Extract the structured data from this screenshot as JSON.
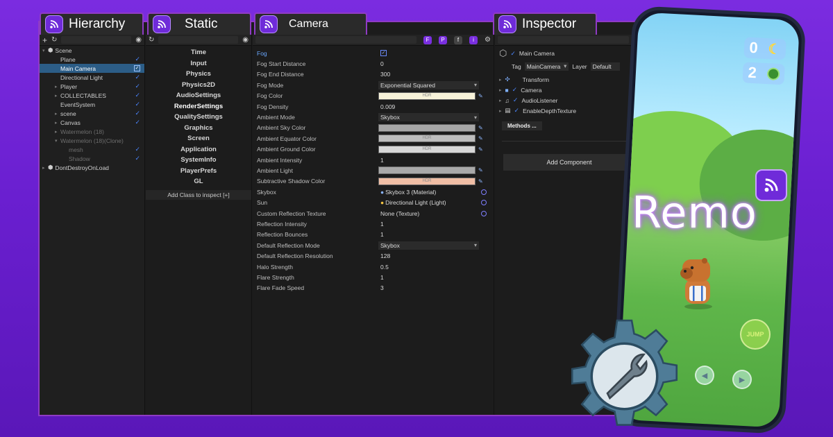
{
  "tabs": {
    "hierarchy": "Hierarchy",
    "static": "Static",
    "camera": "Camera",
    "inspector": "Inspector"
  },
  "hierarchy": {
    "toolbar_add": "+",
    "items": [
      {
        "label": "Scene",
        "indent": 0,
        "expanded": true,
        "bold": true
      },
      {
        "label": "Plane",
        "indent": 1
      },
      {
        "label": "Main Camera",
        "indent": 1,
        "selected": true
      },
      {
        "label": "Directional Light",
        "indent": 1
      },
      {
        "label": "Player",
        "indent": 1,
        "arrow": true
      },
      {
        "label": "COLLECTABLES",
        "indent": 1,
        "arrow": true
      },
      {
        "label": "EventSystem",
        "indent": 1
      },
      {
        "label": "scene",
        "indent": 1,
        "arrow": true
      },
      {
        "label": "Canvas",
        "indent": 1,
        "arrow": true
      },
      {
        "label": "Watermelon (18)",
        "indent": 1,
        "arrow": true,
        "dim": true
      },
      {
        "label": "Watermelon (18)(Clone)",
        "indent": 1,
        "arrow": true,
        "dim": true,
        "expanded": true
      },
      {
        "label": "mesh",
        "indent": 2,
        "dim": true
      },
      {
        "label": "Shadow",
        "indent": 2,
        "dim": true
      },
      {
        "label": "DontDestroyOnLoad",
        "indent": 0,
        "arrow": true
      }
    ]
  },
  "static": {
    "items": [
      "Time",
      "Input",
      "Physics",
      "Physics2D",
      "AudioSettings",
      "RenderSettings",
      "QualitySettings",
      "Graphics",
      "Screen",
      "Application",
      "SystemInfo",
      "PlayerPrefs",
      "GL"
    ],
    "selected": "RenderSettings",
    "add_button": "Add Class to inspect [+]"
  },
  "camera": {
    "toolbar_badges": [
      "F",
      "P",
      "f",
      "i"
    ],
    "properties": [
      {
        "label": "Fog",
        "value": "✓",
        "type": "check",
        "highlight": true
      },
      {
        "label": "Fog Start Distance",
        "value": "0",
        "type": "text"
      },
      {
        "label": "Fog End Distance",
        "value": "300",
        "type": "text"
      },
      {
        "label": "Fog Mode",
        "value": "Exponential Squared",
        "type": "dropdown"
      },
      {
        "label": "Fog Color",
        "value": "HDR",
        "type": "color",
        "color": "#f6f1d8"
      },
      {
        "label": "Fog Density",
        "value": "0.009",
        "type": "text"
      },
      {
        "label": "Ambient Mode",
        "value": "Skybox",
        "type": "dropdown"
      },
      {
        "label": "Ambient Sky Color",
        "value": "",
        "type": "color",
        "color": "#a7a7a7"
      },
      {
        "label": "Ambient Equator Color",
        "value": "HDR",
        "type": "color",
        "color": "#bdbdbd"
      },
      {
        "label": "Ambient Ground Color",
        "value": "HDR",
        "type": "color",
        "color": "#d7d7d7"
      },
      {
        "label": "Ambient Intensity",
        "value": "1",
        "type": "text"
      },
      {
        "label": "Ambient Light",
        "value": "",
        "type": "color",
        "color": "#a9a9a9"
      },
      {
        "label": "Subtractive Shadow Color",
        "value": "HDR",
        "type": "color",
        "color": "#f0bea5"
      },
      {
        "label": "Skybox",
        "value": "Skybox 3 (Material)",
        "type": "object"
      },
      {
        "label": "Sun",
        "value": "Directional Light (Light)",
        "type": "object"
      },
      {
        "label": "Custom Reflection Texture",
        "value": "None (Texture)",
        "type": "object"
      },
      {
        "label": "Reflection Intensity",
        "value": "1",
        "type": "text"
      },
      {
        "label": "Reflection Bounces",
        "value": "1",
        "type": "text"
      },
      {
        "label": "Default Reflection Mode",
        "value": "Skybox",
        "type": "dropdown"
      },
      {
        "label": "Default Reflection Resolution",
        "value": "128",
        "type": "text"
      },
      {
        "label": "Halo Strength",
        "value": "0.5",
        "type": "text"
      },
      {
        "label": "Flare Strength",
        "value": "1",
        "type": "text"
      },
      {
        "label": "Flare Fade Speed",
        "value": "3",
        "type": "text"
      }
    ]
  },
  "inspector": {
    "object_name": "Main Camera",
    "tag_label": "Tag",
    "tag_value": "MainCamera",
    "layer_label": "Layer",
    "layer_value": "Default",
    "components": [
      "Transform",
      "Camera",
      "AudioListener",
      "EnableDepthTexture"
    ],
    "methods_button": "Methods ...",
    "add_component": "Add Component"
  },
  "game": {
    "banana_count": "0",
    "melon_count": "2",
    "jump_label": "JUMP"
  },
  "brand": {
    "title": "Remo",
    "accent": "#7a2fe0",
    "frame": "#8f3bc4"
  }
}
